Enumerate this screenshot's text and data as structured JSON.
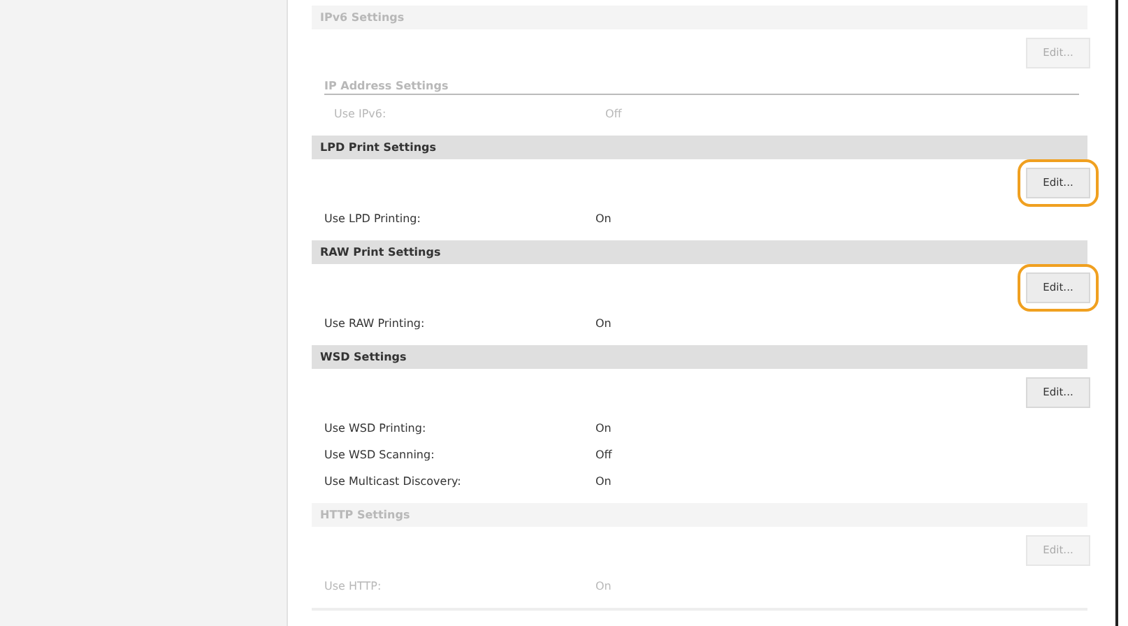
{
  "sections": [
    {
      "title": "IPv6 Settings",
      "disabled": true,
      "edit_button": {
        "label": "Edit...",
        "highlighted": false
      },
      "subheading": "IP Address Settings",
      "rows": [
        {
          "label": "Use IPv6:",
          "value": "Off"
        }
      ]
    },
    {
      "title": "LPD Print Settings",
      "disabled": false,
      "edit_button": {
        "label": "Edit...",
        "highlighted": true
      },
      "rows": [
        {
          "label": "Use LPD Printing:",
          "value": "On"
        }
      ]
    },
    {
      "title": "RAW Print Settings",
      "disabled": false,
      "edit_button": {
        "label": "Edit...",
        "highlighted": true
      },
      "rows": [
        {
          "label": "Use RAW Printing:",
          "value": "On"
        }
      ]
    },
    {
      "title": "WSD Settings",
      "disabled": false,
      "edit_button": {
        "label": "Edit...",
        "highlighted": false
      },
      "rows": [
        {
          "label": "Use WSD Printing:",
          "value": "On"
        },
        {
          "label": "Use WSD Scanning:",
          "value": "Off"
        },
        {
          "label": "Use Multicast Discovery:",
          "value": "On"
        }
      ]
    },
    {
      "title": "HTTP Settings",
      "disabled": true,
      "edit_button": {
        "label": "Edit...",
        "highlighted": false
      },
      "rows": [
        {
          "label": "Use HTTP:",
          "value": "On"
        }
      ]
    }
  ]
}
